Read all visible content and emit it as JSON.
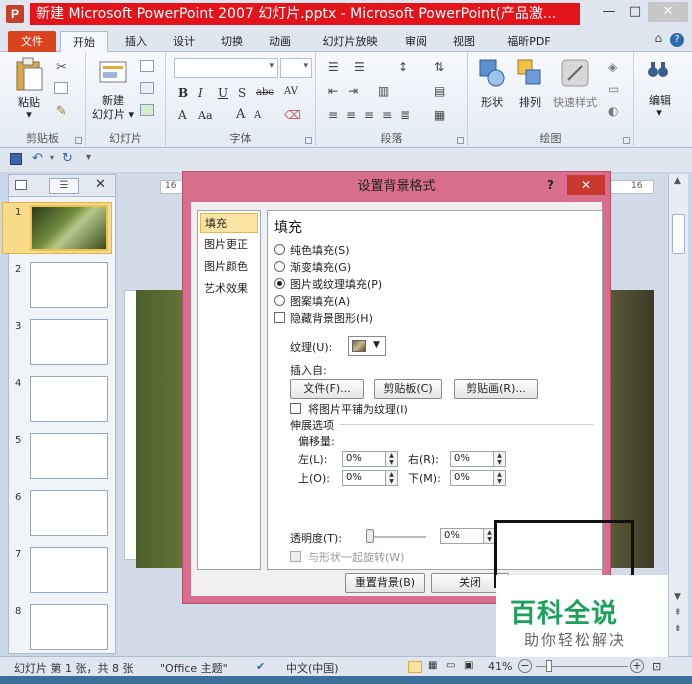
{
  "window": {
    "app_icon": "P",
    "title": "新建 Microsoft PowerPoint 2007 幻灯片.pptx - Microsoft PowerPoint(产品激...",
    "minimize": "—",
    "maximize": "□",
    "close": "✕"
  },
  "ribbon_tabs": [
    "文件",
    "开始",
    "插入",
    "设计",
    "切换",
    "动画",
    "幻灯片放映",
    "审阅",
    "视图",
    "福昕PDF"
  ],
  "ribbon": {
    "clipboard": {
      "paste": "粘贴",
      "group": "剪贴板"
    },
    "slides": {
      "new_slide": "新建\n幻灯片",
      "new_slide_line1": "新建",
      "new_slide_line2": "幻灯片 ▾",
      "group": "幻灯片"
    },
    "font": {
      "group": "字体",
      "bold": "B",
      "italic": "I",
      "underline": "U",
      "strike": "S",
      "abc": "abc",
      "av": "AV",
      "font_a": "A",
      "aa": "Aa",
      "grow": "A",
      "shrink": "A"
    },
    "paragraph": {
      "group": "段落"
    },
    "drawing": {
      "shapes": "形状",
      "arrange": "排列",
      "quick_styles": "快速样式",
      "group": "绘图"
    },
    "editing": {
      "label": "编辑"
    }
  },
  "slide_pane": {
    "close": "✕",
    "slides": [
      "1",
      "2",
      "3",
      "4",
      "5",
      "6",
      "7",
      "8"
    ]
  },
  "ruler": {
    "h_left": "16",
    "h_right": "16"
  },
  "dialog": {
    "title": "设置背景格式",
    "help": "?",
    "close": "✕",
    "nav": [
      "填充",
      "图片更正",
      "图片颜色",
      "艺术效果"
    ],
    "section_title": "填充",
    "fill_options": [
      {
        "label": "纯色填充(S)",
        "checked": false
      },
      {
        "label": "渐变填充(G)",
        "checked": false
      },
      {
        "label": "图片或纹理填充(P)",
        "checked": true
      },
      {
        "label": "图案填充(A)",
        "checked": false
      }
    ],
    "hide_bg_graphics": "隐藏背景图形(H)",
    "texture_label": "纹理(U):",
    "insert_from": "插入自:",
    "file_btn": "文件(F)...",
    "clipboard_btn": "剪贴板(C)",
    "clipart_btn": "剪贴画(R)...",
    "tile_label": "将图片平铺为纹理(I)",
    "stretch_options": "伸展选项",
    "offsets": "偏移量:",
    "left": {
      "label": "左(L):",
      "value": "0%"
    },
    "right": {
      "label": "右(R):",
      "value": "0%"
    },
    "top": {
      "label": "上(O):",
      "value": "0%"
    },
    "bottom": {
      "label": "下(M):",
      "value": "0%"
    },
    "transparency": {
      "label": "透明度(T):",
      "value": "0%",
      "level": 0
    },
    "rotate_with_shape": "与形状一起旋转(W)",
    "reset_btn": "重置背景(B)",
    "close_btn": "关闭"
  },
  "status": {
    "slide_info": "幻灯片 第 1 张，共 8 张",
    "theme": "\"Office 主题\"",
    "language": "中文(中国)",
    "zoom": "41%",
    "zoom_minus": "−",
    "zoom_plus": "+"
  },
  "watermark": {
    "main": "百科全说",
    "sub": "助你轻松解决"
  }
}
